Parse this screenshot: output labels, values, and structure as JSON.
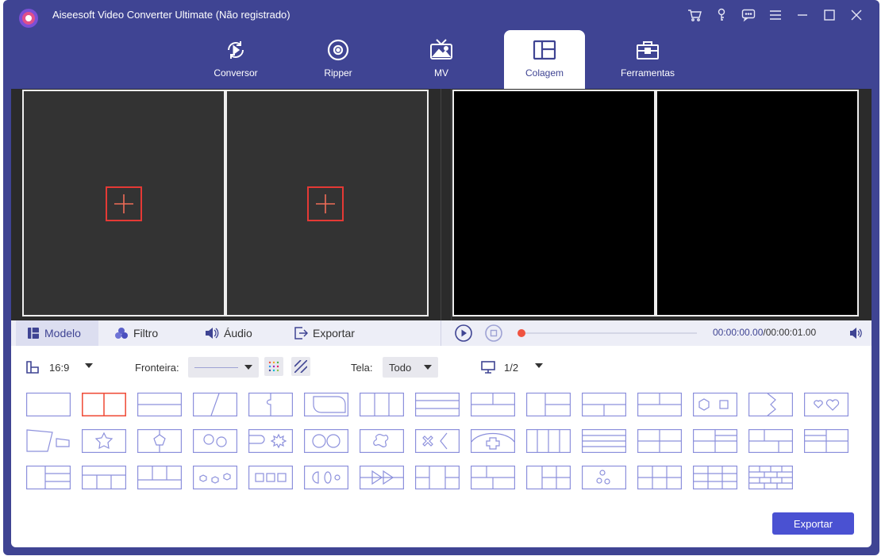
{
  "window": {
    "title": "Aiseesoft Video Converter Ultimate (Não registrado)",
    "controls": [
      "cart-icon",
      "key-icon",
      "chat-icon",
      "menu-icon",
      "minimize-icon",
      "maximize-icon",
      "close-icon"
    ]
  },
  "nav": {
    "tabs": [
      {
        "label": "Conversor",
        "icon": "convert-icon"
      },
      {
        "label": "Ripper",
        "icon": "disc-icon"
      },
      {
        "label": "MV",
        "icon": "tv-icon"
      },
      {
        "label": "Colagem",
        "icon": "collage-icon",
        "active": true
      },
      {
        "label": "Ferramentas",
        "icon": "toolbox-icon"
      }
    ]
  },
  "subtabs": {
    "model": "Modelo",
    "filter": "Filtro",
    "audio": "Áudio",
    "export": "Exportar"
  },
  "player": {
    "current_time": "00:00:00.00",
    "duration": "/00:00:01.00"
  },
  "options": {
    "ratio": "16:9",
    "border_label": "Fronteira:",
    "screen_label": "Tela:",
    "screen_value": "Todo",
    "page": "1/2"
  },
  "export_button": "Exportar",
  "colors": {
    "brand": "#3f4493",
    "accent": "#4a51d2",
    "template_stroke": "#8c90dc",
    "selected_template": "#f05340",
    "add_border": "#e53935"
  }
}
